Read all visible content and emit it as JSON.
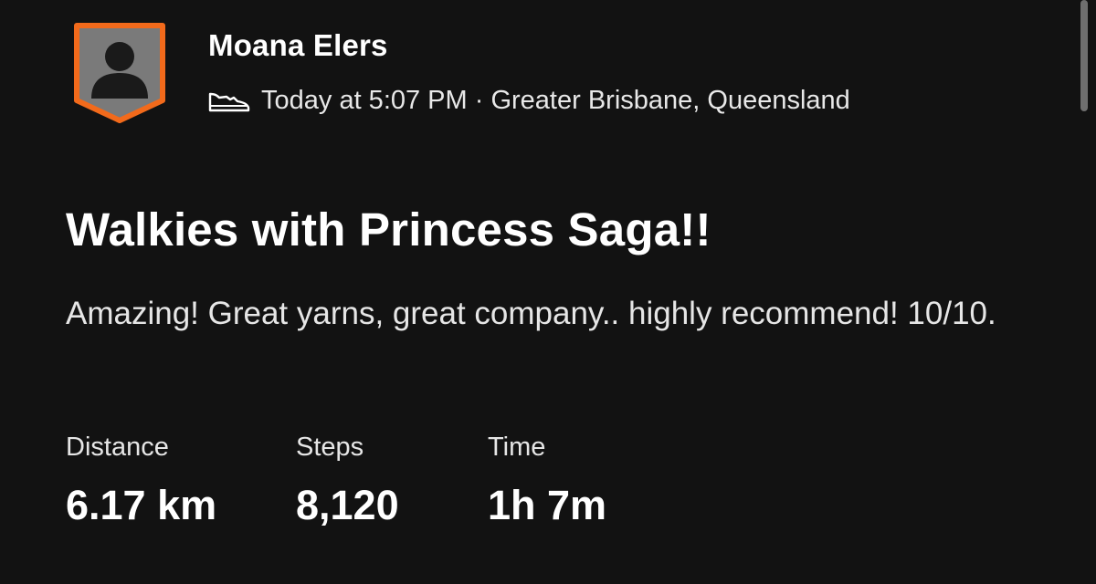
{
  "post": {
    "athlete_name": "Moana Elers",
    "avatar_icon": "user-silhouette-icon",
    "activity_icon": "shoe-icon",
    "meta": "Today at 5:07 PM · Greater Brisbane, Queensland",
    "title": "Walkies with Princess Saga!!",
    "description": "Amazing! Great yarns, great company.. highly recommend! 10/10.",
    "stats": {
      "distance": {
        "label": "Distance",
        "value": "6.17 km"
      },
      "steps": {
        "label": "Steps",
        "value": "8,120"
      },
      "time": {
        "label": "Time",
        "value": "1h 7m"
      }
    }
  },
  "colors": {
    "background": "#121212",
    "text": "#ffffff",
    "badge_border": "#f26a1b",
    "badge_fill": "#7a7a7a"
  }
}
